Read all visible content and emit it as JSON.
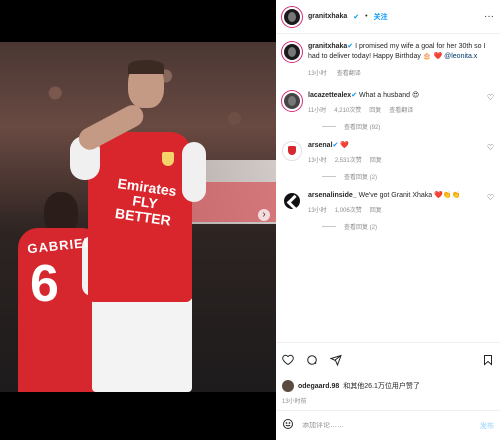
{
  "header": {
    "username": "granitxhaka",
    "verified_badge": "✔",
    "separator": "•",
    "follow_label": "关注",
    "more_label": "···"
  },
  "photo": {
    "back_player_name": "GABRIEL",
    "back_player_number": "6",
    "sponsor_text": "Emirates FLY BETTER"
  },
  "caption": {
    "username": "granitxhaka",
    "text": " I promised my wife a goal for her 30th so I had to deliver today! Happy Birthday 🎂 ❤️ ",
    "mention": "@leonita.x",
    "time": "13小时",
    "translate": "查看翻译"
  },
  "comments": [
    {
      "username": "lacazettealex",
      "text": " What a husband 😍",
      "time": "11小时",
      "likes": "4,210次赞",
      "reply": "回复",
      "translate": "查看翻译",
      "replies": "查看回复 (92)"
    },
    {
      "username": "arsenal",
      "text": " ❤️",
      "time": "13小时",
      "likes": "2,531次赞",
      "reply": "回复",
      "translate": "",
      "replies": "查看回复 (2)"
    },
    {
      "username": "arsenalinside_",
      "text": " We've got Granit Xhaka ❤️👏👏",
      "time": "13小时",
      "likes": "1,006次赞",
      "reply": "回复",
      "translate": "",
      "replies": "查看回复 (2)"
    }
  ],
  "actions": {
    "icons": [
      "heart-icon",
      "comment-icon",
      "share-icon",
      "bookmark-icon"
    ]
  },
  "likes": {
    "user": "odegaard.98",
    "text": "和其他26.1万位用户赞了"
  },
  "post_time": "13小时前",
  "add_comment": {
    "placeholder": "添加评论……",
    "post_label": "发布"
  },
  "colors": {
    "accent": "#0095f6",
    "arsenal_red": "#d9262d"
  }
}
